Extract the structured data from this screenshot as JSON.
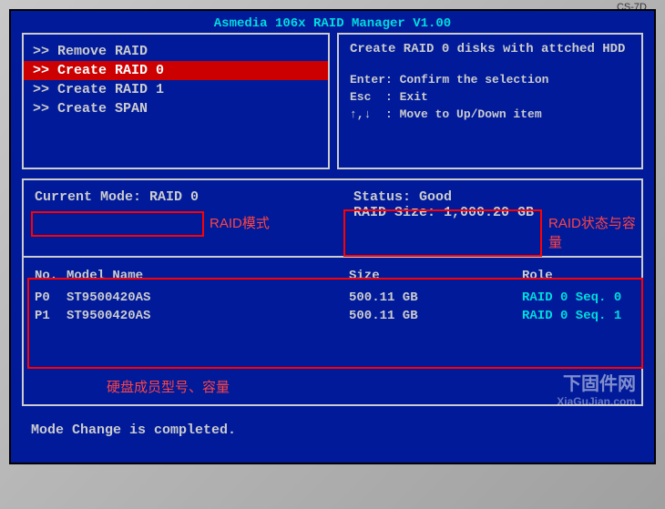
{
  "title": "Asmedia 106x RAID Manager V1.00",
  "menu": {
    "items": [
      {
        "label": ">> Remove RAID",
        "selected": false
      },
      {
        "label": ">> Create RAID 0",
        "selected": true
      },
      {
        "label": ">> Create RAID 1",
        "selected": false
      },
      {
        "label": ">> Create SPAN",
        "selected": false
      }
    ]
  },
  "help": {
    "title": "Create RAID 0 disks with attched HDD",
    "lines": [
      "Enter: Confirm the selection",
      "Esc  : Exit",
      "↑,↓  : Move to Up/Down item"
    ]
  },
  "info": {
    "current_mode_label": "Current Mode:",
    "current_mode_value": "RAID 0",
    "status_label": "Status:",
    "status_value": "Good",
    "raid_size_label": "RAID Size:",
    "raid_size_value": "1,000.20 GB"
  },
  "disk_table": {
    "headers": {
      "no": "No.",
      "model": "Model Name",
      "size": "Size",
      "role": "Role"
    },
    "rows": [
      {
        "no": "P0",
        "model": "ST9500420AS",
        "size": "500.11 GB",
        "role": "RAID 0 Seq. 0"
      },
      {
        "no": "P1",
        "model": "ST9500420AS",
        "size": "500.11 GB",
        "role": "RAID 0 Seq. 1"
      }
    ]
  },
  "footer": "Mode Change is completed.",
  "annotations": {
    "mode": "RAID模式",
    "status": "RAID状态与容量",
    "disks": "硬盘成员型号、容量"
  },
  "monitor_label": "CS-7D",
  "watermark": {
    "main": "下固件网",
    "sub": "XiaGuJian.com"
  }
}
